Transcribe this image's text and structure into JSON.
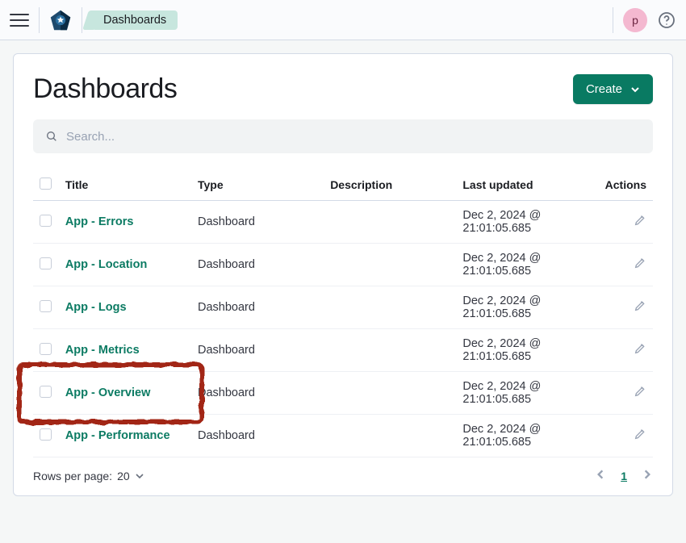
{
  "header": {
    "breadcrumb": "Dashboards",
    "avatar_letter": "p"
  },
  "page": {
    "title": "Dashboards",
    "create_label": "Create",
    "search_placeholder": "Search..."
  },
  "table": {
    "columns": {
      "title": "Title",
      "type": "Type",
      "description": "Description",
      "last_updated": "Last updated",
      "actions": "Actions"
    },
    "rows": [
      {
        "title": "App - Errors",
        "type": "Dashboard",
        "description": "",
        "last_updated": "Dec 2, 2024 @ 21:01:05.685",
        "highlighted": false
      },
      {
        "title": "App - Location",
        "type": "Dashboard",
        "description": "",
        "last_updated": "Dec 2, 2024 @ 21:01:05.685",
        "highlighted": false
      },
      {
        "title": "App - Logs",
        "type": "Dashboard",
        "description": "",
        "last_updated": "Dec 2, 2024 @ 21:01:05.685",
        "highlighted": false
      },
      {
        "title": "App - Metrics",
        "type": "Dashboard",
        "description": "",
        "last_updated": "Dec 2, 2024 @ 21:01:05.685",
        "highlighted": false
      },
      {
        "title": "App - Overview",
        "type": "Dashboard",
        "description": "",
        "last_updated": "Dec 2, 2024 @ 21:01:05.685",
        "highlighted": true
      },
      {
        "title": "App - Performance",
        "type": "Dashboard",
        "description": "",
        "last_updated": "Dec 2, 2024 @ 21:01:05.685",
        "highlighted": false
      }
    ]
  },
  "footer": {
    "rows_per_page_label": "Rows per page:",
    "rows_per_page_value": "20",
    "current_page": "1"
  }
}
